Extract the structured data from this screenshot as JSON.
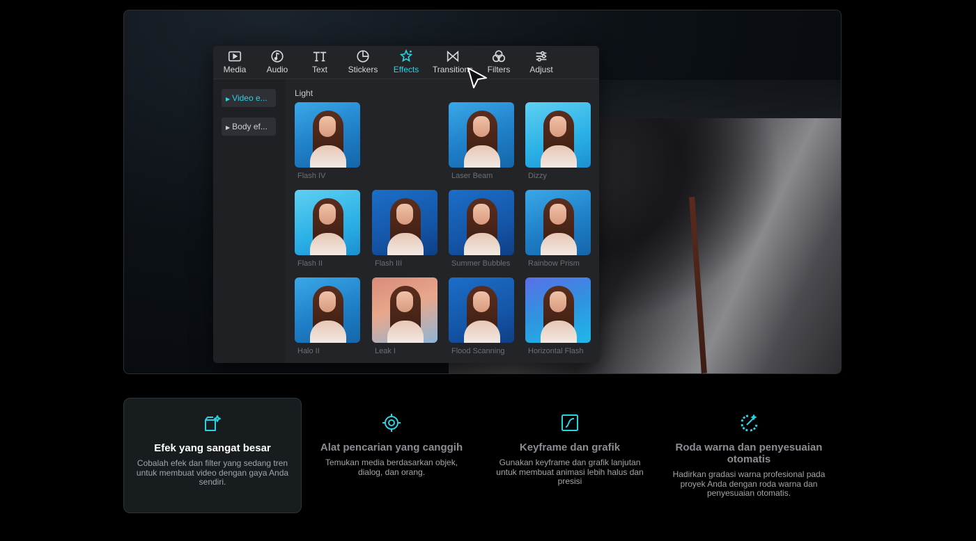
{
  "colors": {
    "accent": "#25d4e5",
    "panel": "#232428",
    "background": "#000000"
  },
  "editor": {
    "tabs": [
      {
        "label": "Media",
        "icon": "play-box-icon"
      },
      {
        "label": "Audio",
        "icon": "music-note-icon"
      },
      {
        "label": "Text",
        "icon": "text-tt-icon"
      },
      {
        "label": "Stickers",
        "icon": "sticker-icon"
      },
      {
        "label": "Effects",
        "icon": "sparkle-star-icon"
      },
      {
        "label": "Transitions",
        "icon": "bowtie-icon"
      },
      {
        "label": "Filters",
        "icon": "three-circles-icon"
      },
      {
        "label": "Adjust",
        "icon": "sliders-icon"
      }
    ],
    "active_tab": "Effects",
    "categories": [
      {
        "label": "Video e..."
      },
      {
        "label": "Body ef..."
      }
    ],
    "section_label": "Light",
    "effects": [
      {
        "label": "Flash IV"
      },
      {
        "label": "Laser Beam"
      },
      {
        "label": "Dizzy"
      },
      {
        "label": "Flash II"
      },
      {
        "label": "Flash III"
      },
      {
        "label": "Summer Bubbles"
      },
      {
        "label": "Rainbow Prism"
      },
      {
        "label": "Halo II"
      },
      {
        "label": "Leak I"
      },
      {
        "label": "Flood Scanning"
      },
      {
        "label": "Horizontal Flash"
      }
    ]
  },
  "features": [
    {
      "icon": "effects-sparkle-box-icon",
      "title": "Efek yang sangat besar",
      "description": "Cobalah efek dan filter yang sedang tren untuk membuat video dengan gaya Anda sendiri."
    },
    {
      "icon": "target-search-icon",
      "title": "Alat pencarian yang canggih",
      "description": "Temukan media berdasarkan objek, dialog, dan orang."
    },
    {
      "icon": "keyframe-curve-icon",
      "title": "Keyframe dan grafik",
      "description": "Gunakan keyframe dan grafik lanjutan untuk membuat animasi lebih halus dan presisi"
    },
    {
      "icon": "color-wheel-wand-icon",
      "title": "Roda warna dan penyesuaian otomatis",
      "description": "Hadirkan gradasi warna profesional pada proyek Anda dengan roda warna dan penyesuaian otomatis."
    }
  ]
}
